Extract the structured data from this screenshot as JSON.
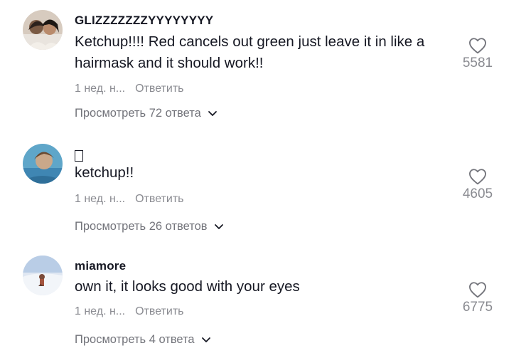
{
  "comments": [
    {
      "username": "GLIZZZZZZZYYYYYYYY",
      "text": "Ketchup!!!! Red cancels out green just leave it in like a hairmask and it should work!!",
      "date": "1 нед. н...",
      "reply_label": "Ответить",
      "view_replies": "Просмотреть 72 ответа",
      "likes": "5581",
      "avatar_icon": "avatar-photo-two-people"
    },
    {
      "username": "",
      "text": "ketchup!!",
      "date": "1 нед. н...",
      "reply_label": "Ответить",
      "view_replies": "Просмотреть 26 ответов",
      "likes": "4605",
      "avatar_icon": "avatar-photo-water"
    },
    {
      "username": "miamore",
      "text": "own it, it looks good with your eyes",
      "date": "1 нед. н...",
      "reply_label": "Ответить",
      "view_replies": "Просмотреть 4 ответа",
      "likes": "6775",
      "avatar_icon": "avatar-photo-snow"
    }
  ],
  "icons": {
    "like": "heart-outline-icon",
    "expand": "chevron-down-icon"
  },
  "colors": {
    "text": "#161823",
    "secondary": "#8a8b91",
    "background": "#ffffff"
  }
}
